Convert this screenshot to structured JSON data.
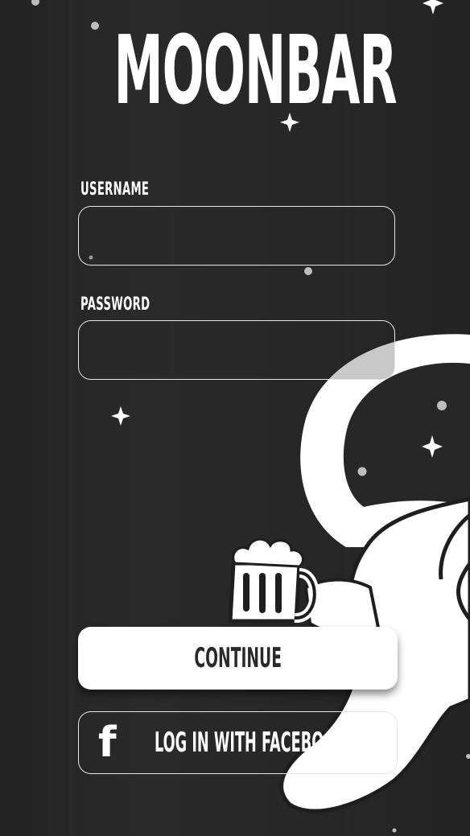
{
  "app": {
    "title": "MOONBAR"
  },
  "form": {
    "username": {
      "label": "USERNAME",
      "value": "",
      "placeholder": ""
    },
    "password": {
      "label": "PASSWORD",
      "value": "",
      "placeholder": ""
    }
  },
  "actions": {
    "continue_label": "CONTINUE",
    "facebook_label": "LOG IN WITH FACEBOOK",
    "facebook_icon": "facebook-f-icon"
  },
  "colors": {
    "background": "#262626",
    "foreground": "#ffffff",
    "button_text": "#2a2a2a"
  }
}
